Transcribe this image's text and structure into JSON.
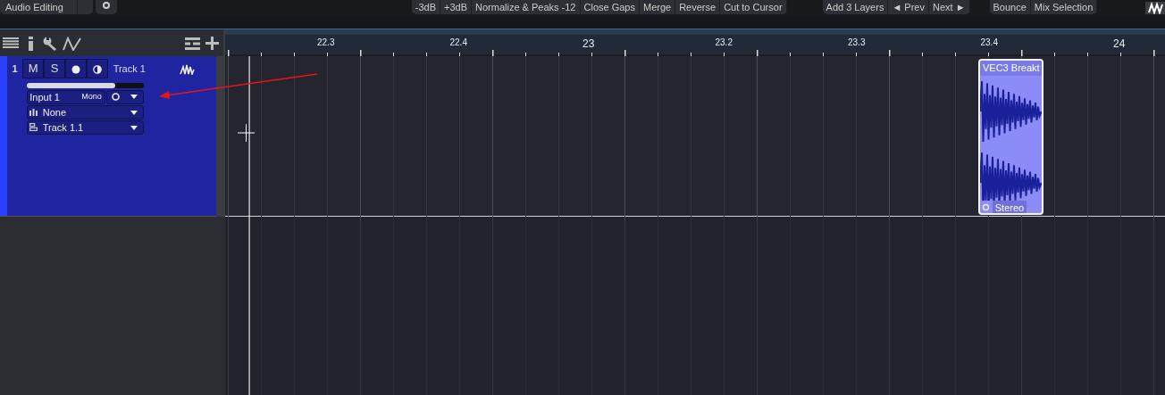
{
  "toolbar": {
    "preset": "Audio Editing",
    "groups": [
      [
        "-3dB",
        "+3dB",
        "Normalize & Peaks -12",
        "Close Gaps",
        "Merge",
        "Reverse",
        "Cut to Cursor"
      ],
      [
        "Add 3 Layers",
        "◄ Prev",
        "Next ►"
      ],
      [
        "Bounce",
        "Mix Selection"
      ]
    ]
  },
  "ruler": {
    "labels": [
      "22.3",
      "22.4",
      "23",
      "23.2",
      "23.3",
      "23.4",
      "24"
    ]
  },
  "tracks": [
    {
      "number": "1",
      "buttons": [
        "M",
        "S"
      ],
      "name": "Track 1",
      "level": 0.76,
      "input": "Input 1",
      "channel_mode": "Mono",
      "input_monitor": false,
      "insert": "None",
      "output": "Track 1.1"
    }
  ],
  "clips": [
    {
      "name": "VEC3 Breakt",
      "format": "Stereo"
    }
  ]
}
